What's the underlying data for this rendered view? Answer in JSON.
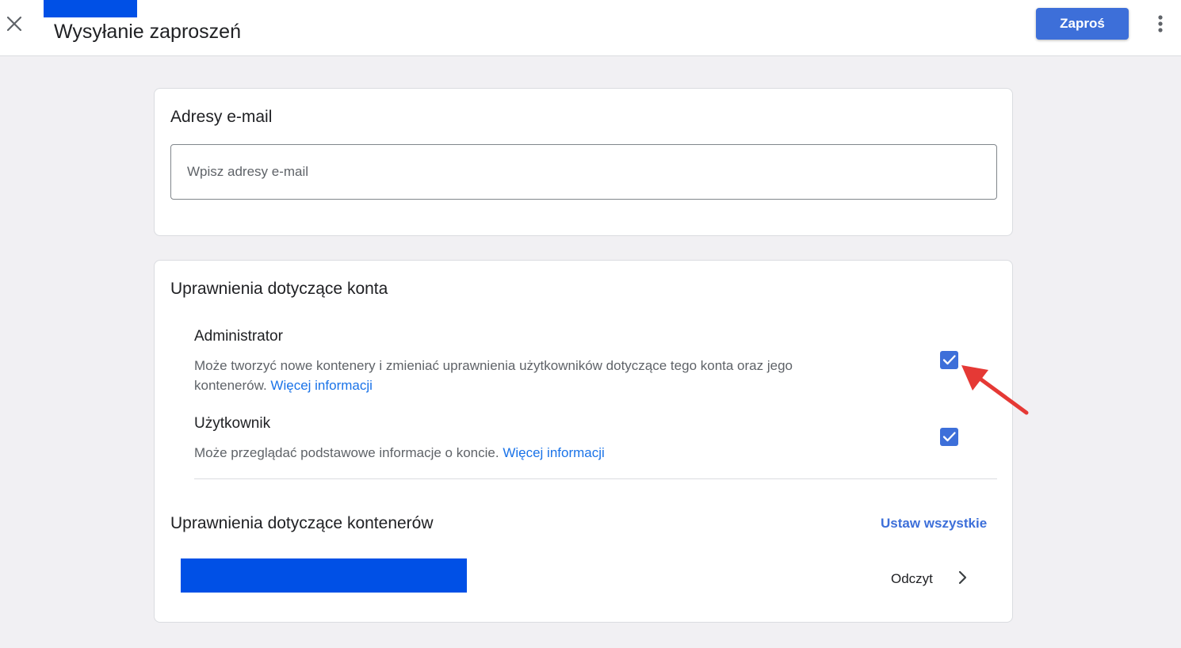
{
  "header": {
    "title": "Wysyłanie zaproszeń",
    "invite_label": "Zaproś"
  },
  "email_section": {
    "title": "Adresy e-mail",
    "placeholder": "Wpisz adresy e-mail",
    "value": ""
  },
  "account_permissions": {
    "title": "Uprawnienia dotyczące konta",
    "roles": [
      {
        "title": "Administrator",
        "description": "Może tworzyć nowe kontenery i zmieniać uprawnienia użytkowników dotyczące tego konta oraz jego kontenerów.",
        "link": "Więcej informacji",
        "checked": true
      },
      {
        "title": "Użytkownik",
        "description": "Może przeglądać podstawowe informacje o koncie.",
        "link": "Więcej informacji",
        "checked": true
      }
    ]
  },
  "container_permissions": {
    "title": "Uprawnienia dotyczące kontenerów",
    "set_all_label": "Ustaw wszystkie",
    "rows": [
      {
        "access": "Odczyt"
      }
    ]
  },
  "icons": {
    "close": "close-icon",
    "more": "more-vert-icon",
    "check": "check-icon",
    "chevron": "chevron-right-icon",
    "annotation": "red-arrow-icon"
  },
  "colors": {
    "accent": "#3d6fd9",
    "link": "#1a73e8",
    "redaction": "#0050e6",
    "annotation": "#e53935",
    "background": "#f1f0f3"
  }
}
